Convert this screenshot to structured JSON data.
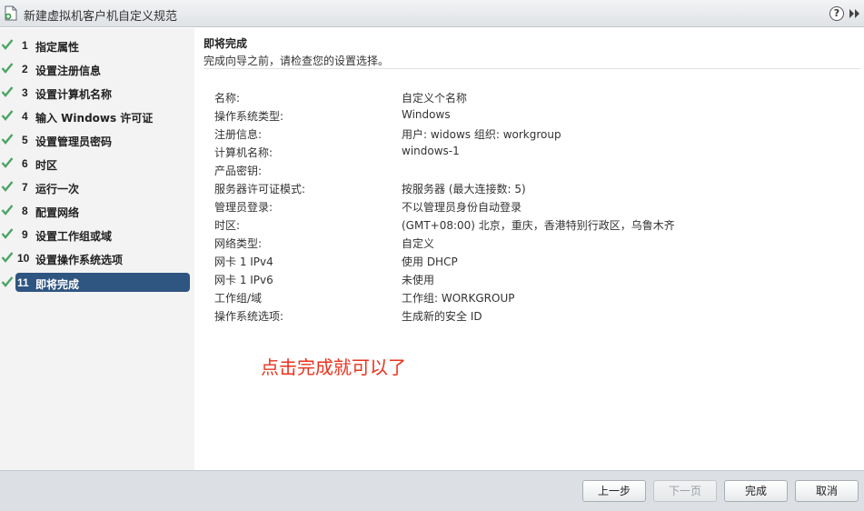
{
  "window": {
    "title": "新建虚拟机客户机自定义规范",
    "help_glyph": "?"
  },
  "steps": [
    {
      "num": "1",
      "label": "指定属性",
      "done": true
    },
    {
      "num": "2",
      "label": "设置注册信息",
      "done": true
    },
    {
      "num": "3",
      "label": "设置计算机名称",
      "done": true
    },
    {
      "num": "4",
      "label": "输入 Windows 许可证",
      "done": true
    },
    {
      "num": "5",
      "label": "设置管理员密码",
      "done": true
    },
    {
      "num": "6",
      "label": "时区",
      "done": true
    },
    {
      "num": "7",
      "label": "运行一次",
      "done": true
    },
    {
      "num": "8",
      "label": "配置网络",
      "done": true
    },
    {
      "num": "9",
      "label": "设置工作组或域",
      "done": true
    },
    {
      "num": "10",
      "label": "设置操作系统选项",
      "done": true
    },
    {
      "num": "11",
      "label": "即将完成",
      "done": true,
      "active": true
    }
  ],
  "main": {
    "title": "即将完成",
    "subtitle": "完成向导之前，请检查您的设置选择。",
    "summary": [
      {
        "key": "名称:",
        "value": "自定义个名称"
      },
      {
        "key": "操作系统类型:",
        "value": "Windows"
      },
      {
        "key": "注册信息:",
        "value": "用户: widows 组织: workgroup"
      },
      {
        "key": "计算机名称:",
        "value": "windows-1"
      },
      {
        "key": "产品密钥:",
        "value": ""
      },
      {
        "key": "服务器许可证模式:",
        "value": "按服务器 (最大连接数: 5)"
      },
      {
        "key": "管理员登录:",
        "value": "不以管理员身份自动登录"
      },
      {
        "key": "时区:",
        "value": "(GMT+08:00) 北京，重庆，香港特别行政区，乌鲁木齐"
      },
      {
        "key": "网络类型:",
        "value": "自定义"
      },
      {
        "key": "网卡 1 IPv4",
        "value": "使用 DHCP"
      },
      {
        "key": "网卡 1 IPv6",
        "value": "未使用"
      },
      {
        "key": "工作组/域",
        "value": "工作组: WORKGROUP"
      },
      {
        "key": "操作系统选项:",
        "value": "生成新的安全 ID"
      }
    ],
    "annotation": "点击完成就可以了"
  },
  "footer": {
    "back_label": "上一步",
    "next_label": "下一页",
    "finish_label": "完成",
    "cancel_label": "取消"
  },
  "colors": {
    "check": "#4aa564",
    "active_step": "#2f5581",
    "annotation": "#e8331e"
  }
}
